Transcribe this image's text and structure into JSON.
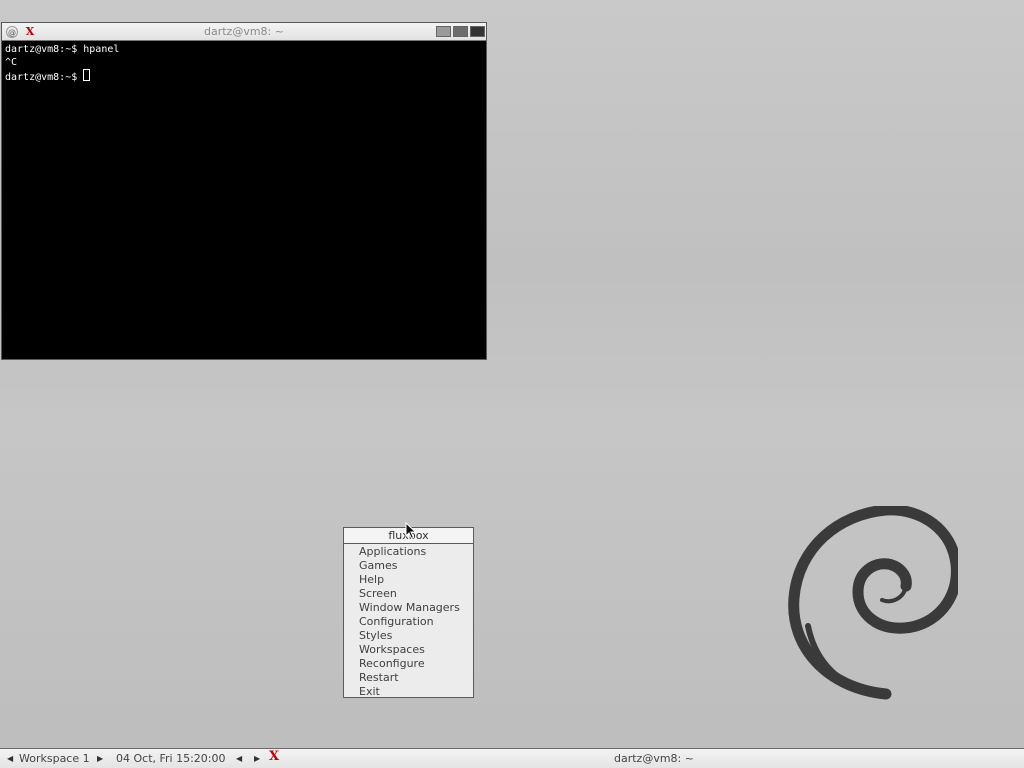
{
  "terminal": {
    "title": "dartz@vm8: ~",
    "lines": [
      "dartz@vm8:~$ hpanel",
      "^C",
      "dartz@vm8:~$ "
    ]
  },
  "menu": {
    "title": "fluxbox",
    "items": [
      {
        "label": "Applications"
      },
      {
        "label": "Games"
      },
      {
        "label": "Help"
      },
      {
        "label": "Screen"
      },
      {
        "label": "Window Managers"
      },
      {
        "label": "Configuration"
      },
      {
        "label": "Styles"
      },
      {
        "label": "Workspaces"
      },
      {
        "label": "Reconfigure"
      },
      {
        "label": "Restart"
      },
      {
        "label": "Exit"
      }
    ]
  },
  "toolbar": {
    "workspace": "Workspace 1",
    "clock": "04 Oct, Fri 15:20:00",
    "task": "dartz@vm8: ~"
  },
  "colors": {
    "terminal_bg": "#000000",
    "terminal_fg": "#ffffff",
    "xterm_icon": "#c00000",
    "swirl": "#3a3a3a"
  },
  "icons": {
    "terminal_menu": "debian-swirl-icon",
    "terminal_app": "xterm-icon",
    "toolbar_app": "xterm-icon"
  }
}
